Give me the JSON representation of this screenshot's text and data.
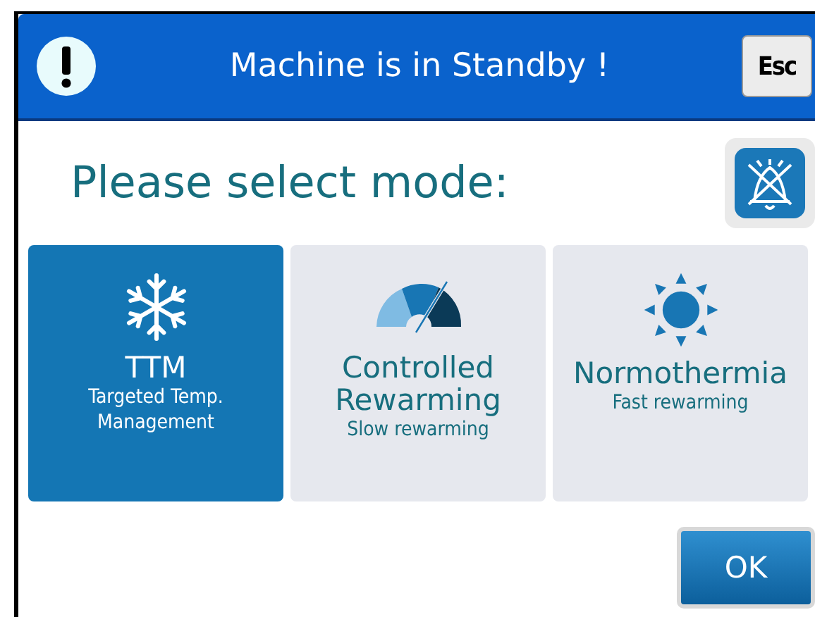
{
  "header": {
    "title": "Machine is in Standby !",
    "esc_button": "Esc"
  },
  "prompt": "Please select mode:",
  "modes": [
    {
      "kind": "snowflake",
      "title": "TTM",
      "subtitle": "Targeted Temp. Management",
      "selected": true
    },
    {
      "kind": "gauge",
      "title": "Controlled Rewarming",
      "subtitle": "Slow rewarming",
      "selected": false
    },
    {
      "kind": "sun",
      "title": "Normothermia",
      "subtitle": "Fast rewarming",
      "selected": false
    }
  ],
  "ok_button": "OK"
}
